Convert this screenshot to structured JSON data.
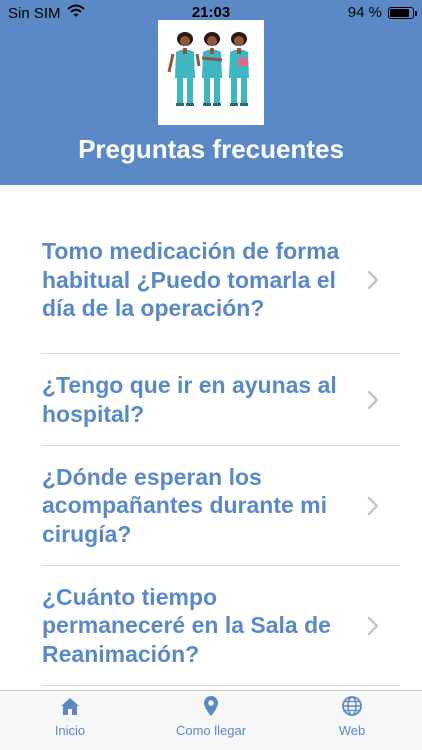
{
  "status_bar": {
    "carrier": "Sin SIM",
    "time": "21:03",
    "battery": "94 %",
    "battery_level": 0.94,
    "wifi_icon": "wifi-icon",
    "battery_icon": "battery-icon"
  },
  "header": {
    "title": "Preguntas frecuentes",
    "logo_icon": "nurses-illustration",
    "background_color": "#5b89c6"
  },
  "faq": {
    "items": [
      {
        "question": "Tomo medicación de forma habitual ¿Puedo tomarla el día de la operación?"
      },
      {
        "question": "¿Tengo que ir en ayunas al hospital?"
      },
      {
        "question": "¿Dónde esperan los acompañantes durante mi cirugía?"
      },
      {
        "question": "¿Cuánto tiempo permaneceré en la Sala de Reanimación?"
      }
    ],
    "text_color": "#5b89c6"
  },
  "tabbar": {
    "tabs": [
      {
        "label": "Inicio",
        "icon": "home-icon"
      },
      {
        "label": "Como llegar",
        "icon": "location-pin-icon"
      },
      {
        "label": "Web",
        "icon": "globe-icon"
      }
    ]
  }
}
